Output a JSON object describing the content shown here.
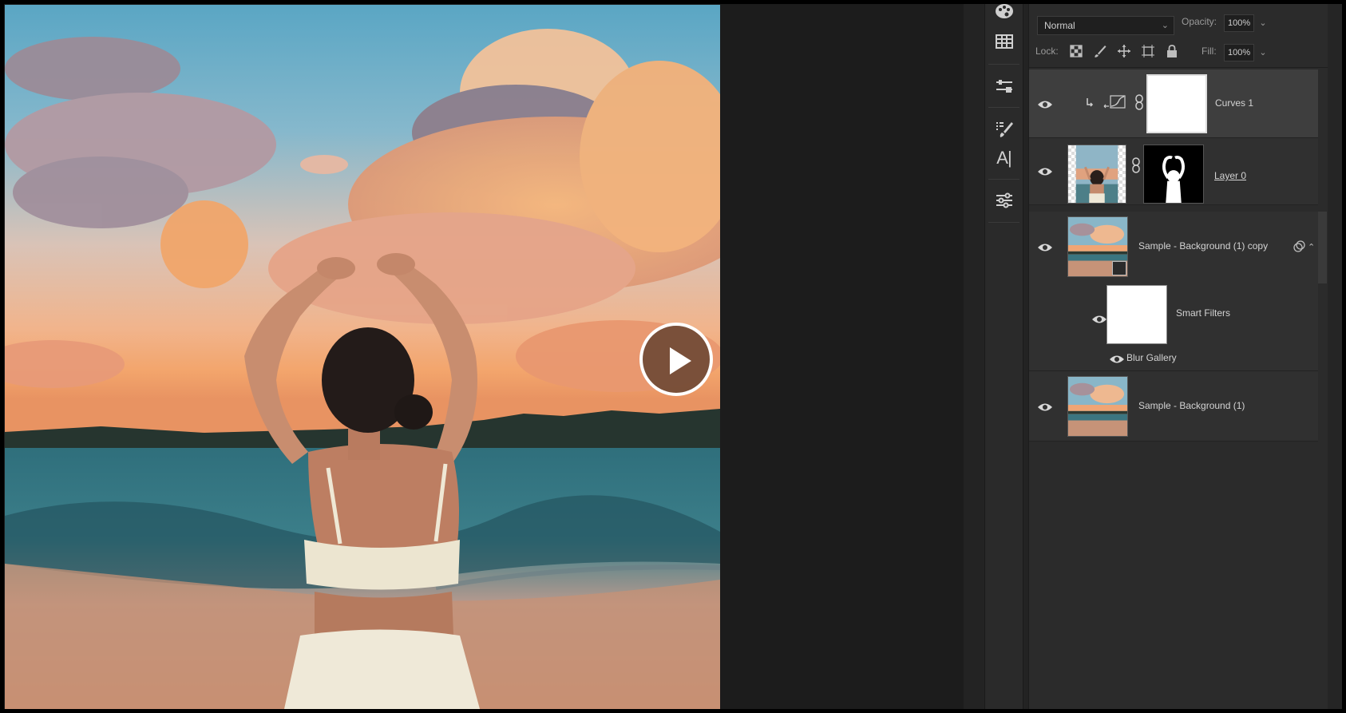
{
  "video": {
    "play_button": "play-icon"
  },
  "layers_panel": {
    "blend_mode": "Normal",
    "opacity_label": "Opacity:",
    "opacity_value": "100%",
    "lock_label": "Lock:",
    "fill_label": "Fill:",
    "fill_value": "100%",
    "lock_icons": [
      "lock-transparent-pixels-icon",
      "lock-image-pixels-icon",
      "lock-position-icon",
      "lock-artboard-icon",
      "lock-all-icon"
    ],
    "layers": [
      {
        "name": "Curves 1",
        "type": "adjustment",
        "selected": true,
        "visible": true
      },
      {
        "name": "Layer 0",
        "type": "pixel-with-mask",
        "selected": false,
        "visible": true
      },
      {
        "name": "Sample - Background (1) copy",
        "type": "smart-object",
        "selected": false,
        "visible": true
      },
      {
        "name": "Smart Filters",
        "type": "smart-filters",
        "selected": false,
        "visible": true
      },
      {
        "name": "Blur Gallery",
        "type": "filter",
        "selected": false,
        "visible": true
      },
      {
        "name": "Sample - Background (1)",
        "type": "pixel",
        "selected": false,
        "visible": true
      }
    ]
  },
  "toolstrip": {
    "tools": [
      "color-palette-icon",
      "grid-table-icon",
      "adjustment-sliders-icon",
      "brush-settings-icon",
      "type-tool-icon",
      "properties-icon"
    ],
    "type_tool_glyph": "A|"
  }
}
